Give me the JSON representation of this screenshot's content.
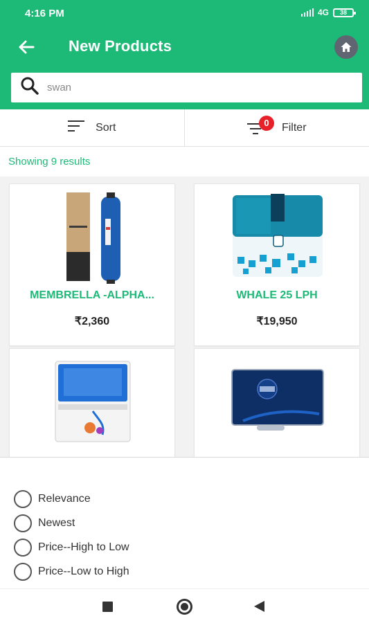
{
  "status_bar": {
    "time": "4:16 PM",
    "network": "4G",
    "battery": "38"
  },
  "app_bar": {
    "title": "New Products",
    "back_icon": "arrow-left-icon",
    "home_icon": "home-icon"
  },
  "search": {
    "value": "swan",
    "icon": "search-icon"
  },
  "sort_filter": {
    "sort_label": "Sort",
    "filter_label": "Filter",
    "filter_count": "0"
  },
  "results": {
    "count_text": "Showing 9 results"
  },
  "products": [
    {
      "name": "MEMBRELLA -ALPHA...",
      "price": "₹2,360"
    },
    {
      "name": "WHALE 25 LPH",
      "price": "₹19,950"
    },
    {
      "name": "",
      "price": ""
    },
    {
      "name": "",
      "price": ""
    }
  ],
  "sort_options": [
    "Relevance",
    "Newest",
    "Price--High to Low",
    "Price--Low to High"
  ],
  "nav_bar": {
    "icons": [
      "recent-apps-icon",
      "home-circle-icon",
      "back-triangle-icon"
    ]
  },
  "colors": {
    "primary": "#1dba77",
    "badge": "#e8202a",
    "home_button": "#5f6672"
  }
}
